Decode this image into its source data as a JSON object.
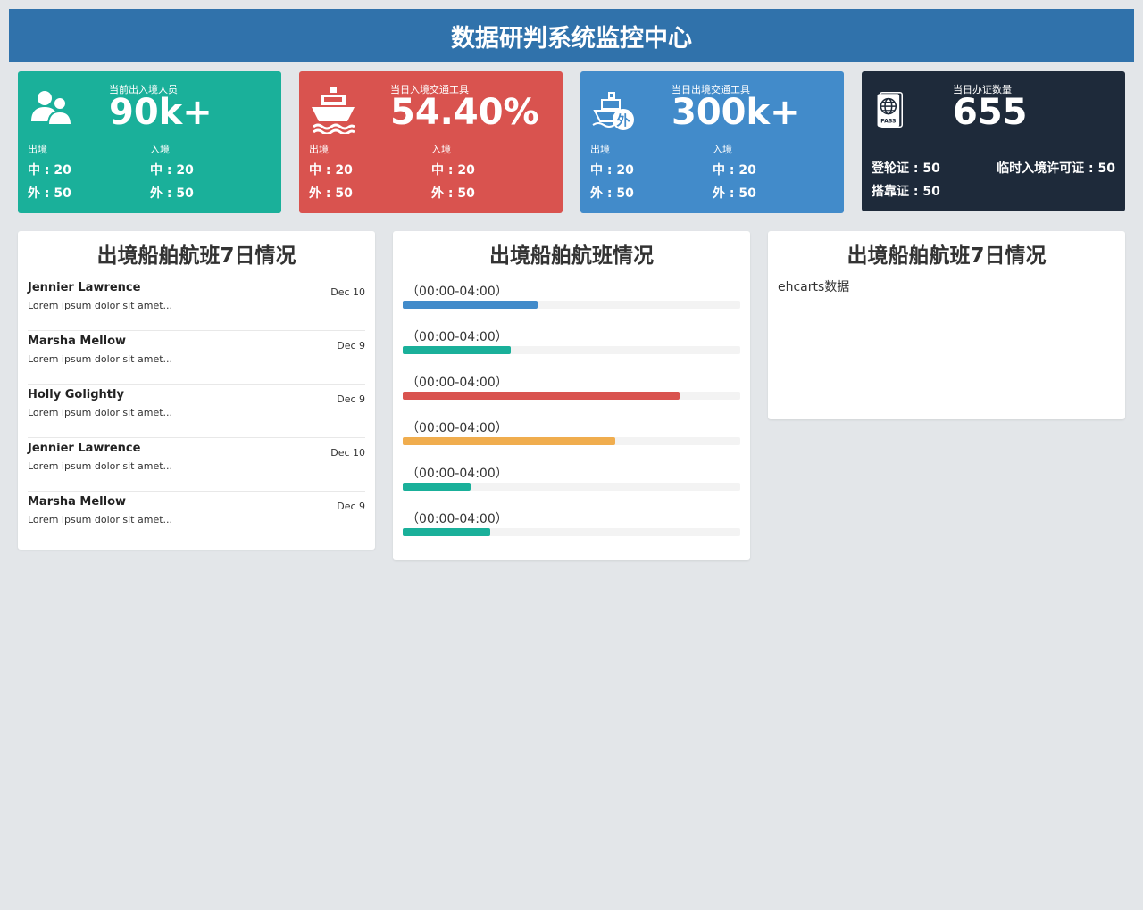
{
  "header": {
    "title": "数据研判系统监控中心"
  },
  "stats": [
    {
      "icon": "people-icon",
      "label": "当前出入境人员",
      "value": "90k+",
      "col1_label": "出境",
      "col2_label": "入境",
      "col1_r1": "中 : 20",
      "col1_r2": "外 : 50",
      "col2_r1": "中 : 20",
      "col2_r2": "外 : 50"
    },
    {
      "icon": "ship-icon",
      "label": "当日入境交通工具",
      "value": "54.40%",
      "col1_label": "出境",
      "col2_label": "入境",
      "col1_r1": "中 : 20",
      "col1_r2": "外 : 50",
      "col2_r1": "中 : 20",
      "col2_r2": "外 : 50"
    },
    {
      "icon": "foreign-ship-icon",
      "icon_text": "外",
      "label": "当日出境交通工具",
      "value": "300k+",
      "col1_label": "出境",
      "col2_label": "入境",
      "col1_r1": "中 : 20",
      "col1_r2": "外 : 50",
      "col2_r1": "中 : 20",
      "col2_r2": "外 : 50"
    },
    {
      "icon": "passport-icon",
      "icon_text": "PASS",
      "label": "当日办证数量",
      "value": "655",
      "line1": "登轮证 : 50",
      "line2": "临时入境许可证 : 50",
      "line3": "搭靠证 : 50"
    }
  ],
  "panel_list": {
    "title": "出境船舶航班7日情况",
    "items": [
      {
        "name": "Jennier Lawrence",
        "desc": "Lorem ipsum dolor sit amet...",
        "date": "Dec 10"
      },
      {
        "name": "Marsha Mellow",
        "desc": "Lorem ipsum dolor sit amet...",
        "date": "Dec 9"
      },
      {
        "name": "Holly Golightly",
        "desc": "Lorem ipsum dolor sit amet...",
        "date": "Dec 9"
      },
      {
        "name": "Jennier Lawrence",
        "desc": "Lorem ipsum dolor sit amet...",
        "date": "Dec 10"
      },
      {
        "name": "Marsha Mellow",
        "desc": "Lorem ipsum dolor sit amet...",
        "date": "Dec 9"
      }
    ]
  },
  "panel_bars": {
    "title": "出境船舶航班情况",
    "bars": [
      {
        "label": "（00:00-04:00）",
        "percent": 40,
        "color": "#428bca"
      },
      {
        "label": "（00:00-04:00）",
        "percent": 32,
        "color": "#1ab09a"
      },
      {
        "label": "（00:00-04:00）",
        "percent": 82,
        "color": "#d9534f"
      },
      {
        "label": "（00:00-04:00）",
        "percent": 63,
        "color": "#f0ad4e"
      },
      {
        "label": "（00:00-04:00）",
        "percent": 20,
        "color": "#1ab09a"
      },
      {
        "label": "（00:00-04:00）",
        "percent": 26,
        "color": "#1ab09a"
      }
    ]
  },
  "panel_chart": {
    "title": "出境船舶航班7日情况",
    "text": "ehcarts数据"
  }
}
